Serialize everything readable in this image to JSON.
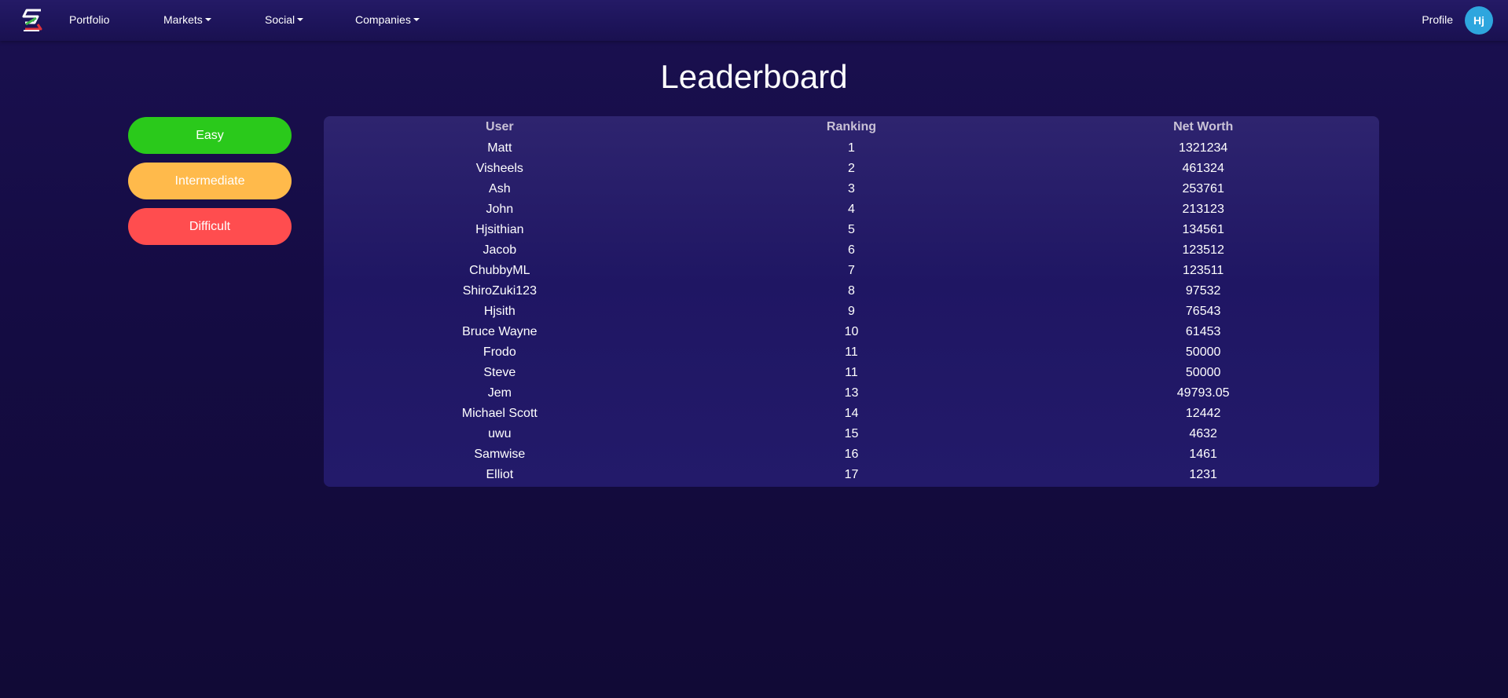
{
  "nav": {
    "portfolio": "Portfolio",
    "markets": "Markets",
    "social": "Social",
    "companies": "Companies",
    "profile": "Profile",
    "avatar_initials": "Hj"
  },
  "page": {
    "title": "Leaderboard"
  },
  "difficulty": {
    "easy": "Easy",
    "intermediate": "Intermediate",
    "difficult": "Difficult"
  },
  "table": {
    "headers": [
      "User",
      "Ranking",
      "Net Worth"
    ],
    "rows": [
      [
        "Matt",
        "1",
        "1321234"
      ],
      [
        "Visheels",
        "2",
        "461324"
      ],
      [
        "Ash",
        "3",
        "253761"
      ],
      [
        "John",
        "4",
        "213123"
      ],
      [
        "Hjsithian",
        "5",
        "134561"
      ],
      [
        "Jacob",
        "6",
        "123512"
      ],
      [
        "ChubbyML",
        "7",
        "123511"
      ],
      [
        "ShiroZuki123",
        "8",
        "97532"
      ],
      [
        "Hjsith",
        "9",
        "76543"
      ],
      [
        "Bruce Wayne",
        "10",
        "61453"
      ],
      [
        "Frodo",
        "11",
        "50000"
      ],
      [
        "Steve",
        "11",
        "50000"
      ],
      [
        "Jem",
        "13",
        "49793.05"
      ],
      [
        "Michael Scott",
        "14",
        "12442"
      ],
      [
        "uwu",
        "15",
        "4632"
      ],
      [
        "Samwise",
        "16",
        "1461"
      ],
      [
        "Elliot",
        "17",
        "1231"
      ]
    ]
  },
  "colors": {
    "easy": "#2ac91b",
    "intermediate": "#ffba4b",
    "difficult": "#ff4d4f",
    "avatar": "#2ea6de",
    "background": "#150c44"
  },
  "icons": {
    "logo": "stocks-s-logo-icon",
    "dropdown": "caret-down-icon"
  }
}
